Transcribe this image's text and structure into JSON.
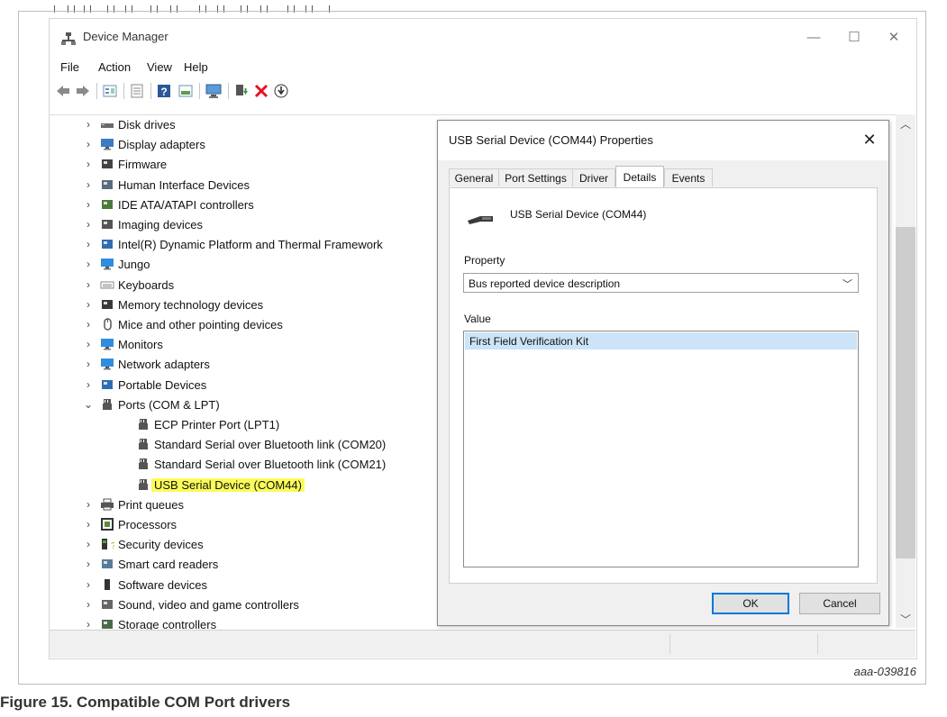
{
  "window": {
    "title": "Device Manager",
    "controls": {
      "minimize": "—",
      "maximize": "☐",
      "close": "✕"
    }
  },
  "menu": [
    "File",
    "Action",
    "View",
    "Help"
  ],
  "tree": {
    "items": [
      {
        "label": "Disk drives",
        "icon": "disk-icon",
        "expanded": false
      },
      {
        "label": "Display adapters",
        "icon": "display-icon",
        "expanded": false
      },
      {
        "label": "Firmware",
        "icon": "firmware-icon",
        "expanded": false
      },
      {
        "label": "Human Interface Devices",
        "icon": "hid-icon",
        "expanded": false
      },
      {
        "label": "IDE ATA/ATAPI controllers",
        "icon": "ide-icon",
        "expanded": false
      },
      {
        "label": "Imaging devices",
        "icon": "camera-icon",
        "expanded": false
      },
      {
        "label": "Intel(R) Dynamic Platform and Thermal Framework",
        "icon": "folder-icon",
        "expanded": false
      },
      {
        "label": "Jungo",
        "icon": "monitor-icon",
        "expanded": false
      },
      {
        "label": "Keyboards",
        "icon": "keyboard-icon",
        "expanded": false
      },
      {
        "label": "Memory technology devices",
        "icon": "memory-icon",
        "expanded": false
      },
      {
        "label": "Mice and other pointing devices",
        "icon": "mouse-icon",
        "expanded": false
      },
      {
        "label": "Monitors",
        "icon": "monitor-icon",
        "expanded": false
      },
      {
        "label": "Network adapters",
        "icon": "network-icon",
        "expanded": false
      },
      {
        "label": "Portable Devices",
        "icon": "portable-icon",
        "expanded": false
      },
      {
        "label": "Ports (COM & LPT)",
        "icon": "port-icon",
        "expanded": true
      },
      {
        "label": "ECP Printer Port (LPT1)",
        "icon": "port-icon",
        "child": true
      },
      {
        "label": "Standard Serial over Bluetooth link (COM20)",
        "icon": "port-icon",
        "child": true
      },
      {
        "label": "Standard Serial over Bluetooth link (COM21)",
        "icon": "port-icon",
        "child": true
      },
      {
        "label": "USB Serial Device (COM44)",
        "icon": "port-icon",
        "child": true,
        "highlighted": true
      },
      {
        "label": "Print queues",
        "icon": "printer-icon",
        "expanded": false
      },
      {
        "label": "Processors",
        "icon": "processor-icon",
        "expanded": false
      },
      {
        "label": "Security devices",
        "icon": "security-icon",
        "expanded": false
      },
      {
        "label": "Smart card readers",
        "icon": "smartcard-icon",
        "expanded": false
      },
      {
        "label": "Software devices",
        "icon": "software-icon",
        "expanded": false
      },
      {
        "label": "Sound, video and game controllers",
        "icon": "sound-icon",
        "expanded": false
      },
      {
        "label": "Storage controllers",
        "icon": "storage-icon",
        "expanded": false
      }
    ]
  },
  "dialog": {
    "title": "USB Serial Device (COM44) Properties",
    "tabs": [
      "General",
      "Port Settings",
      "Driver",
      "Details",
      "Events"
    ],
    "active_tab": "Details",
    "device_name": "USB Serial Device (COM44)",
    "property_label": "Property",
    "property_value": "Bus reported device description",
    "value_label": "Value",
    "values": [
      "First Field Verification Kit"
    ],
    "ok_label": "OK",
    "cancel_label": "Cancel"
  },
  "colors": {
    "highlight": "#fbfb5a",
    "selection": "#cce4f7",
    "accent": "#0078d7",
    "error_x": "#e81123"
  },
  "figure": {
    "id": "aaa-039816",
    "caption": "Figure 15.  Compatible COM Port drivers"
  }
}
